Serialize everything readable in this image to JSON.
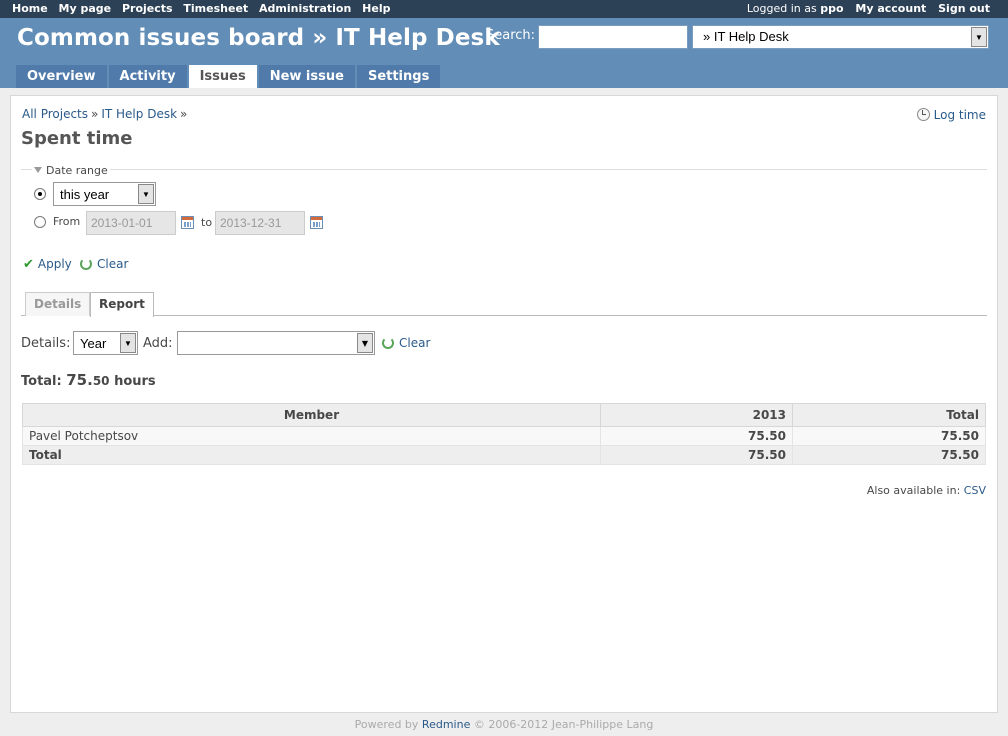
{
  "top_menu": {
    "items": [
      "Home",
      "My page",
      "Projects",
      "Timesheet",
      "Administration",
      "Help"
    ],
    "logged_in_prefix": "Logged in as",
    "user": "ppo",
    "my_account": "My account",
    "sign_out": "Sign out"
  },
  "header": {
    "title": "Common issues board » IT Help Desk",
    "search_label": "Search:",
    "search_value": "",
    "project_jump": "» IT Help Desk"
  },
  "main_menu": {
    "tabs": [
      "Overview",
      "Activity",
      "Issues",
      "New issue",
      "Settings"
    ],
    "selected": "Issues"
  },
  "breadcrumb": {
    "items": [
      "All Projects",
      "IT Help Desk"
    ],
    "sep": "»"
  },
  "log_time": "Log time",
  "page_title": "Spent time",
  "filters": {
    "legend": "Date range",
    "period_value": "this year",
    "from_label": "From",
    "from_value": "2013-01-01",
    "to_label": "to",
    "to_value": "2013-12-31",
    "apply": "Apply",
    "clear": "Clear"
  },
  "tabs": {
    "details": "Details",
    "report": "Report"
  },
  "report_controls": {
    "details_label": "Details:",
    "details_value": "Year",
    "add_label": "Add:",
    "clear": "Clear"
  },
  "total": {
    "label": "Total:",
    "hours_int": "75.",
    "hours_dec": "50",
    "unit": "hours"
  },
  "table": {
    "headers": [
      "Member",
      "2013",
      "Total"
    ],
    "rows": [
      [
        "Pavel Potcheptsov",
        "75.50",
        "75.50"
      ]
    ],
    "total_row": [
      "Total",
      "75.50",
      "75.50"
    ]
  },
  "also_available": {
    "label": "Also available in:",
    "csv": "CSV"
  },
  "footer": {
    "prefix": "Powered by",
    "link": "Redmine",
    "suffix": "© 2006-2012 Jean-Philippe Lang"
  }
}
